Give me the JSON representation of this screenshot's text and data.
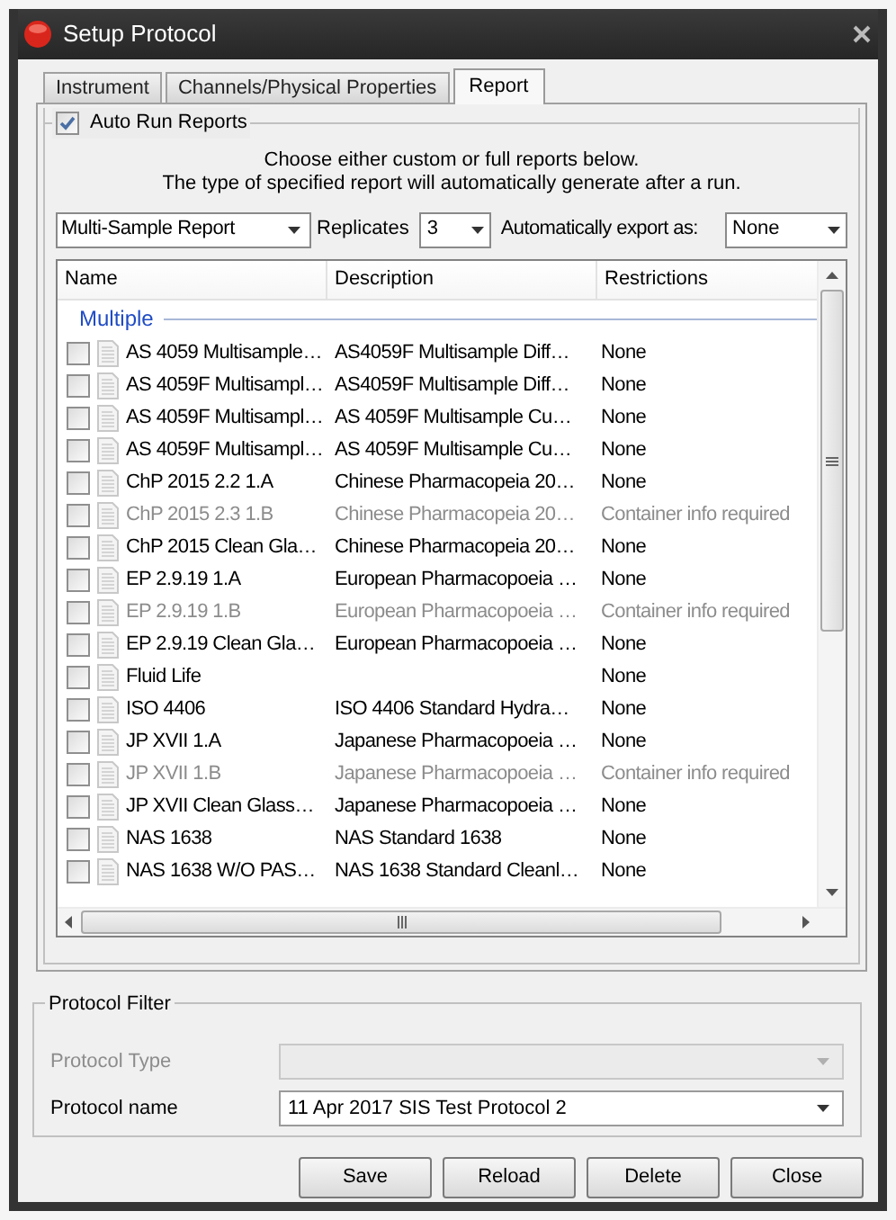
{
  "window": {
    "title": "Setup Protocol"
  },
  "tabs": [
    {
      "label": "Instrument",
      "selected": false
    },
    {
      "label": "Channels/Physical Properties",
      "selected": false
    },
    {
      "label": "Report",
      "selected": true
    }
  ],
  "auto_run_reports": {
    "label": "Auto Run Reports",
    "checked": true
  },
  "instructions": [
    "Choose either custom or full reports below.",
    "The type of specified report will automatically generate after a run."
  ],
  "report_type": {
    "value": "Multi-Sample Report"
  },
  "replicates": {
    "label": "Replicates",
    "value": "3"
  },
  "export": {
    "label": "Automatically export as:",
    "value": "None"
  },
  "table": {
    "columns": [
      "Name",
      "Description",
      "Restrictions"
    ],
    "group": "Multiple",
    "rows": [
      {
        "name": "AS 4059 Multisample…",
        "description": "AS4059F Multisample Diff…",
        "restrictions": "None",
        "checked": false,
        "disabled": false
      },
      {
        "name": "AS 4059F Multisampl…",
        "description": "AS4059F Multisample Diff…",
        "restrictions": "None",
        "checked": false,
        "disabled": false
      },
      {
        "name": "AS 4059F Multisampl…",
        "description": "AS 4059F Multisample Cu…",
        "restrictions": "None",
        "checked": false,
        "disabled": false
      },
      {
        "name": "AS 4059F Multisampl…",
        "description": "AS 4059F Multisample Cu…",
        "restrictions": "None",
        "checked": false,
        "disabled": false
      },
      {
        "name": "ChP 2015 2.2 1.A",
        "description": "Chinese Pharmacopeia 20…",
        "restrictions": "None",
        "checked": false,
        "disabled": false
      },
      {
        "name": "ChP 2015 2.3 1.B",
        "description": "Chinese Pharmacopeia 20…",
        "restrictions": "Container info required",
        "checked": false,
        "disabled": true
      },
      {
        "name": "ChP 2015 Clean Gla…",
        "description": "Chinese Pharmacopeia 20…",
        "restrictions": "None",
        "checked": false,
        "disabled": false
      },
      {
        "name": "EP 2.9.19 1.A",
        "description": "European Pharmacopoeia …",
        "restrictions": "None",
        "checked": false,
        "disabled": false
      },
      {
        "name": "EP 2.9.19 1.B",
        "description": "European Pharmacopoeia …",
        "restrictions": "Container info required",
        "checked": false,
        "disabled": true
      },
      {
        "name": "EP 2.9.19 Clean Gla…",
        "description": "European Pharmacopoeia …",
        "restrictions": "None",
        "checked": false,
        "disabled": false
      },
      {
        "name": "Fluid Life",
        "restrictions": "None",
        "checked": false,
        "disabled": false
      },
      {
        "name": "ISO 4406",
        "description": "ISO 4406 Standard Hydra…",
        "restrictions": "None",
        "checked": false,
        "disabled": false
      },
      {
        "name": "JP XVII 1.A",
        "description": "Japanese Pharmacopoeia …",
        "restrictions": "None",
        "checked": false,
        "disabled": false
      },
      {
        "name": "JP XVII 1.B",
        "description": "Japanese Pharmacopoeia …",
        "restrictions": "Container info required",
        "checked": false,
        "disabled": true
      },
      {
        "name": "JP XVII Clean Glass…",
        "description": "Japanese Pharmacopoeia …",
        "restrictions": "None",
        "checked": false,
        "disabled": false
      },
      {
        "name": "NAS 1638",
        "description": "NAS Standard 1638",
        "restrictions": "None",
        "checked": false,
        "disabled": false
      },
      {
        "name": "NAS 1638 W/O PAS…",
        "description": "NAS 1638 Standard Cleanl…",
        "restrictions": "None",
        "checked": false,
        "disabled": false
      }
    ]
  },
  "protocol_filter": {
    "title": "Protocol Filter",
    "protocol_type": {
      "label": "Protocol Type",
      "disabled": true
    },
    "protocol_name": {
      "label": "Protocol name",
      "value": "11 Apr 2017 SIS Test Protocol 2",
      "disabled": false
    }
  },
  "buttons": [
    "Save",
    "Reload",
    "Delete",
    "Close"
  ]
}
